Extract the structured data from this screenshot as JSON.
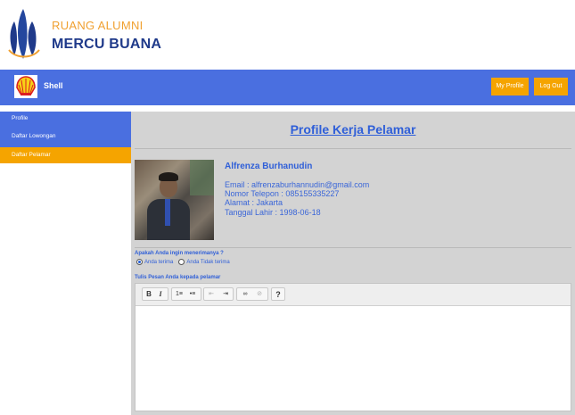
{
  "brand": {
    "line1": "RUANG ALUMNI",
    "line2": "MERCU BUANA"
  },
  "navbar": {
    "company": "Shell",
    "my_profile": "My Profile",
    "logout": "Log Out"
  },
  "sidebar": {
    "items": [
      {
        "label": "Profile"
      },
      {
        "label": "Daftar Lowongan"
      },
      {
        "label": "Daftar Pelamar"
      }
    ]
  },
  "main": {
    "title": "Profile Kerja Pelamar",
    "applicant": {
      "name": "Alfrenza Burhanudin",
      "email": "Email : alfrenzaburhannudin@gmail.com",
      "phone": "Nomor Telepon : 085155335227",
      "address": "Alamat : Jakarta",
      "birth": "Tanggal Lahir : 1998-06-18"
    },
    "question": "Apakah Anda ingin menerimanya ?",
    "options": {
      "accept": "Anda terima",
      "reject": "Anda Tidak terima"
    },
    "message_label": "Tulis Pesan Anda kepada pelamar"
  },
  "toolbar": {
    "bold": "B",
    "italic": "I",
    "ol": "1≡",
    "ul": "•≡",
    "outdent": "⇤",
    "indent": "⇥",
    "link": "∞",
    "unlink": "⊘",
    "help": "?"
  },
  "colors": {
    "primary": "#4a6fe0",
    "accent": "#f5a400",
    "text_blue": "#2f5fd8"
  }
}
